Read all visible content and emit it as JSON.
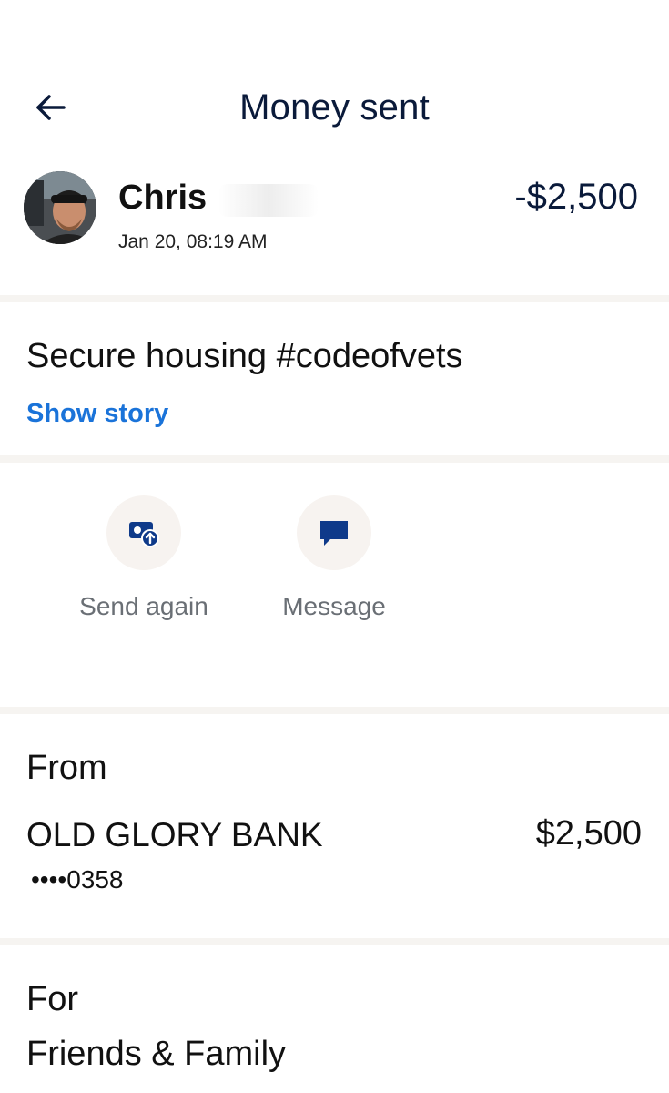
{
  "header": {
    "title": "Money sent",
    "back_icon": "arrow-left-icon"
  },
  "transaction": {
    "name": "Chris",
    "amount": "-$2,500",
    "date": "Jan 20, 08:19 AM"
  },
  "note": {
    "text": "Secure housing #codeofvets",
    "show_story": "Show story"
  },
  "actions": [
    {
      "label": "Send again",
      "icon": "send-again-icon"
    },
    {
      "label": "Message",
      "icon": "message-icon"
    }
  ],
  "from": {
    "label": "From",
    "bank": "OLD GLORY BANK",
    "amount": "$2,500",
    "account": "••••0358"
  },
  "for": {
    "label": "For",
    "value": "Friends & Family"
  },
  "colors": {
    "title_navy": "#0a1a3a",
    "link_blue": "#1a73d9",
    "icon_navy": "#0f3a8a",
    "divider": "#f6f4f1",
    "action_bg": "#f7f3f0"
  }
}
